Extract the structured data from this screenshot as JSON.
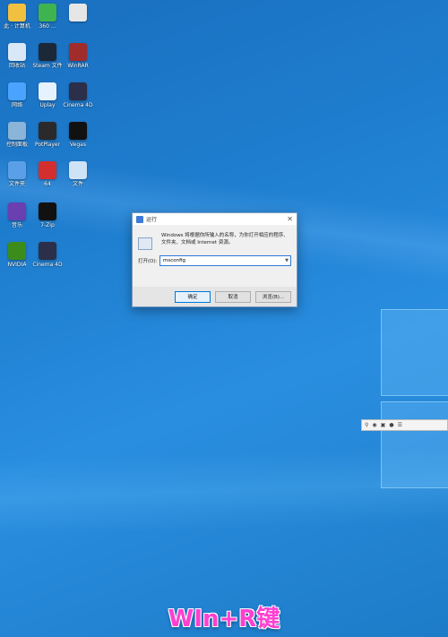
{
  "desktop_icons": [
    {
      "label": "此 · 计算机",
      "icon": "this-pc-icon",
      "color": "#f0c040"
    },
    {
      "label": "360 ...",
      "icon": "app-icon",
      "color": "#3fb34f"
    },
    {
      "label": "",
      "icon": "file-icon",
      "color": "#e6e6e6"
    },
    {
      "label": "回收站",
      "icon": "recycle-bin-icon",
      "color": "#d8e8f6"
    },
    {
      "label": "Steam 文件",
      "icon": "steam-icon",
      "color": "#1b2838"
    },
    {
      "label": "WinRAR",
      "icon": "winrar-icon",
      "color": "#a02c2c"
    },
    {
      "label": "网络",
      "icon": "network-icon",
      "color": "#4aa3ff"
    },
    {
      "label": "Uplay",
      "icon": "uplay-icon",
      "color": "#e6f2ff"
    },
    {
      "label": "Cinema 4D",
      "icon": "cinema4d-icon",
      "color": "#2b2f4a"
    },
    {
      "label": "控制面板",
      "icon": "control-panel-icon",
      "color": "#8ab4d8"
    },
    {
      "label": "PotPlayer",
      "icon": "media-player-icon",
      "color": "#2a2a2a"
    },
    {
      "label": "Vegas",
      "icon": "vegas-icon",
      "color": "#111111"
    },
    {
      "label": "文件夹",
      "icon": "folder-icon",
      "color": "#5aa0e8"
    },
    {
      "label": "64",
      "icon": "app64-icon",
      "color": "#d32f2f"
    },
    {
      "label": "文件",
      "icon": "document-icon",
      "color": "#cfe3f7"
    },
    {
      "label": "音乐",
      "icon": "music-icon",
      "color": "#6a3fb0"
    },
    {
      "label": "7-Zip",
      "icon": "sevenzip-icon",
      "color": "#111111"
    },
    {
      "label": "NVIDIA",
      "icon": "nvidia-icon",
      "color": "#3c8c1c"
    },
    {
      "label": "Cinema 4D",
      "icon": "cinema4d-icon",
      "color": "#2b2f4a"
    }
  ],
  "run_dialog": {
    "title": "运行",
    "description": "Windows 将根据你所输入的名称，为你打开相应的程序、文件夹、文档或 Internet 资源。",
    "open_label": "打开(O):",
    "input_value": "msconfig",
    "ok_label": "确定",
    "cancel_label": "取消",
    "browse_label": "浏览(B)..."
  },
  "caption": "WIn+R键",
  "colors": {
    "accent": "#0078d7",
    "caption": "#ff3fd0"
  }
}
